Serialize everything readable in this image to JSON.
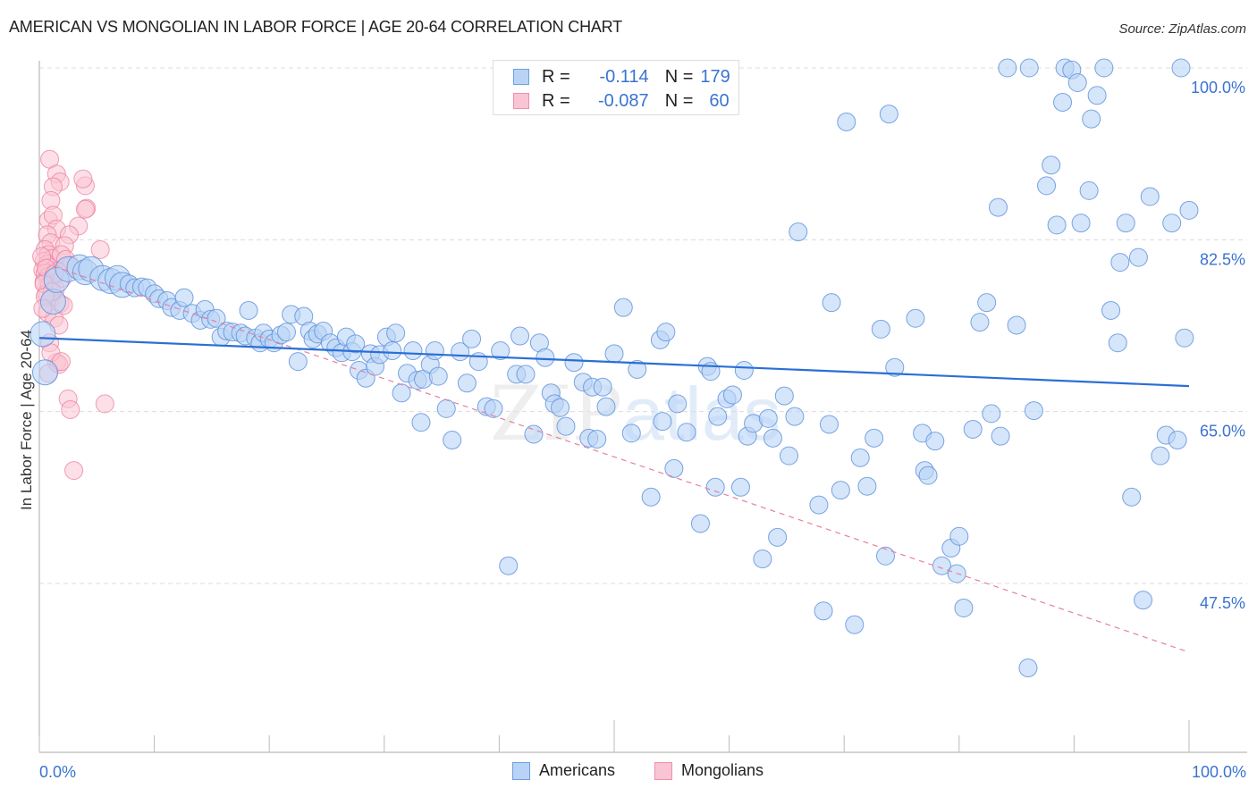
{
  "title": "AMERICAN VS MONGOLIAN IN LABOR FORCE | AGE 20-64 CORRELATION CHART",
  "source": "Source: ZipAtlas.com",
  "watermark": "ZIPatlas",
  "stats_legend": [
    {
      "series": "Americans",
      "r_label": "R =",
      "r_value": "-0.114",
      "n_label": "N =",
      "n_value": "179"
    },
    {
      "series": "Mongolians",
      "r_label": "R =",
      "r_value": "-0.087",
      "n_label": "N =",
      "n_value": "60"
    }
  ],
  "colors": {
    "americans_fill": "#b9d3f7",
    "americans_stroke": "#5b8fd9",
    "americans_trend": "#2a6fd6",
    "mongolians_fill": "#f9c5d4",
    "mongolians_stroke": "#ec7d9d",
    "mongolians_trend": "#e8809c",
    "axis_text": "#3a73d0",
    "grid": "#dcdcdc"
  },
  "chart_data": {
    "type": "scatter",
    "title": "AMERICAN VS MONGOLIAN IN LABOR FORCE | AGE 20-64 CORRELATION CHART",
    "xlabel": "",
    "ylabel": "In Labor Force | Age 20-64",
    "xlim": [
      0,
      100
    ],
    "ylim": [
      31.6,
      102.3
    ],
    "x_tick_labels": [
      "0.0%",
      "100.0%"
    ],
    "x_ticks": [
      0,
      10,
      20,
      30,
      40,
      50,
      60,
      70,
      80,
      90,
      100
    ],
    "y_ticks": [
      100.0,
      82.5,
      65.0,
      47.5
    ],
    "y_tick_labels": [
      "100.0%",
      "82.5%",
      "65.0%",
      "47.5%"
    ],
    "grid": true,
    "legend_position": "bottom-center",
    "legend": [
      "Americans",
      "Mongolians"
    ],
    "series": [
      {
        "name": "Americans",
        "trendline": {
          "x": [
            0,
            100
          ],
          "y": [
            72.5,
            67.6
          ]
        },
        "points": [
          [
            0.3,
            72.9
          ],
          [
            0.5,
            69.0
          ],
          [
            1.2,
            76.2
          ],
          [
            1.5,
            78.4
          ],
          [
            2.5,
            79.5
          ],
          [
            3.5,
            79.7
          ],
          [
            4.0,
            79.2
          ],
          [
            4.5,
            79.5
          ],
          [
            5.5,
            78.6
          ],
          [
            6.2,
            78.3
          ],
          [
            6.8,
            78.6
          ],
          [
            7.2,
            77.9
          ],
          [
            7.8,
            78.0
          ],
          [
            8.3,
            77.6
          ],
          [
            8.9,
            77.7
          ],
          [
            9.4,
            77.6
          ],
          [
            10.0,
            77.0
          ],
          [
            10.4,
            76.5
          ],
          [
            11.1,
            76.3
          ],
          [
            11.5,
            75.6
          ],
          [
            12.2,
            75.3
          ],
          [
            12.6,
            76.6
          ],
          [
            13.3,
            75.0
          ],
          [
            14.0,
            74.3
          ],
          [
            14.4,
            75.4
          ],
          [
            14.9,
            74.4
          ],
          [
            15.4,
            74.5
          ],
          [
            15.8,
            72.6
          ],
          [
            16.3,
            73.2
          ],
          [
            16.8,
            73.1
          ],
          [
            17.5,
            73.0
          ],
          [
            17.9,
            72.7
          ],
          [
            18.2,
            75.3
          ],
          [
            18.8,
            72.5
          ],
          [
            19.2,
            72.0
          ],
          [
            19.5,
            73.0
          ],
          [
            20.0,
            72.4
          ],
          [
            20.4,
            72.0
          ],
          [
            21.0,
            72.8
          ],
          [
            21.5,
            73.1
          ],
          [
            21.9,
            74.9
          ],
          [
            22.5,
            70.1
          ],
          [
            23.0,
            74.7
          ],
          [
            23.5,
            73.2
          ],
          [
            23.8,
            72.4
          ],
          [
            24.2,
            72.9
          ],
          [
            24.7,
            73.2
          ],
          [
            25.3,
            72.0
          ],
          [
            25.8,
            71.5
          ],
          [
            26.3,
            71.0
          ],
          [
            26.7,
            72.6
          ],
          [
            27.2,
            71.1
          ],
          [
            27.5,
            71.9
          ],
          [
            27.8,
            69.2
          ],
          [
            28.4,
            68.4
          ],
          [
            28.8,
            70.9
          ],
          [
            29.2,
            69.6
          ],
          [
            29.6,
            70.8
          ],
          [
            30.2,
            72.6
          ],
          [
            30.7,
            71.2
          ],
          [
            31.0,
            73.0
          ],
          [
            31.5,
            66.9
          ],
          [
            32.0,
            68.9
          ],
          [
            32.5,
            71.2
          ],
          [
            32.9,
            68.2
          ],
          [
            33.2,
            63.9
          ],
          [
            33.4,
            68.3
          ],
          [
            34.0,
            69.8
          ],
          [
            34.4,
            71.2
          ],
          [
            34.7,
            68.6
          ],
          [
            35.4,
            65.3
          ],
          [
            35.9,
            62.1
          ],
          [
            36.6,
            71.1
          ],
          [
            37.2,
            67.9
          ],
          [
            37.6,
            72.4
          ],
          [
            38.2,
            70.1
          ],
          [
            38.9,
            65.5
          ],
          [
            39.5,
            65.3
          ],
          [
            40.1,
            71.2
          ],
          [
            40.8,
            49.3
          ],
          [
            41.5,
            68.8
          ],
          [
            41.8,
            72.7
          ],
          [
            42.3,
            68.8
          ],
          [
            43.0,
            62.7
          ],
          [
            43.5,
            72.0
          ],
          [
            44.0,
            70.5
          ],
          [
            44.5,
            66.9
          ],
          [
            44.8,
            65.8
          ],
          [
            45.3,
            65.4
          ],
          [
            45.8,
            63.5
          ],
          [
            46.5,
            70.0
          ],
          [
            47.3,
            68.0
          ],
          [
            47.8,
            62.3
          ],
          [
            48.1,
            67.5
          ],
          [
            48.5,
            62.2
          ],
          [
            49.0,
            67.5
          ],
          [
            49.3,
            65.5
          ],
          [
            50.0,
            70.9
          ],
          [
            50.8,
            75.6
          ],
          [
            51.5,
            62.8
          ],
          [
            52.0,
            69.3
          ],
          [
            53.2,
            56.3
          ],
          [
            54.0,
            72.3
          ],
          [
            54.2,
            64.0
          ],
          [
            54.5,
            73.1
          ],
          [
            55.2,
            59.2
          ],
          [
            55.5,
            65.8
          ],
          [
            56.3,
            62.9
          ],
          [
            57.5,
            53.6
          ],
          [
            58.1,
            69.6
          ],
          [
            58.4,
            69.1
          ],
          [
            58.8,
            57.3
          ],
          [
            59.0,
            64.5
          ],
          [
            59.8,
            66.3
          ],
          [
            60.3,
            66.7
          ],
          [
            61.0,
            57.3
          ],
          [
            61.3,
            69.2
          ],
          [
            61.6,
            62.5
          ],
          [
            62.1,
            63.8
          ],
          [
            62.9,
            50.0
          ],
          [
            63.4,
            64.3
          ],
          [
            63.8,
            62.3
          ],
          [
            64.2,
            52.2
          ],
          [
            64.8,
            66.6
          ],
          [
            65.2,
            60.5
          ],
          [
            65.7,
            64.5
          ],
          [
            66.0,
            83.3
          ],
          [
            67.8,
            55.5
          ],
          [
            68.2,
            44.7
          ],
          [
            68.7,
            63.7
          ],
          [
            68.9,
            76.1
          ],
          [
            69.7,
            57.0
          ],
          [
            70.2,
            94.5
          ],
          [
            70.9,
            43.3
          ],
          [
            71.4,
            60.3
          ],
          [
            72.0,
            57.4
          ],
          [
            72.6,
            62.3
          ],
          [
            73.2,
            73.4
          ],
          [
            73.6,
            50.3
          ],
          [
            73.9,
            95.3
          ],
          [
            74.4,
            69.5
          ],
          [
            76.2,
            74.5
          ],
          [
            76.8,
            62.8
          ],
          [
            77.0,
            59.0
          ],
          [
            77.3,
            58.5
          ],
          [
            77.9,
            62.0
          ],
          [
            78.5,
            49.3
          ],
          [
            79.3,
            51.1
          ],
          [
            79.8,
            48.5
          ],
          [
            80.0,
            52.3
          ],
          [
            80.4,
            45.0
          ],
          [
            81.2,
            63.2
          ],
          [
            81.8,
            74.1
          ],
          [
            82.4,
            76.1
          ],
          [
            82.8,
            64.8
          ],
          [
            83.4,
            85.8
          ],
          [
            83.6,
            62.5
          ],
          [
            84.2,
            100.0
          ],
          [
            85.0,
            73.8
          ],
          [
            86.0,
            38.9
          ],
          [
            86.1,
            100.0
          ],
          [
            86.5,
            65.1
          ],
          [
            87.6,
            88.0
          ],
          [
            88.0,
            90.1
          ],
          [
            88.5,
            84.0
          ],
          [
            89.0,
            96.5
          ],
          [
            89.2,
            100.0
          ],
          [
            89.8,
            99.8
          ],
          [
            90.3,
            98.5
          ],
          [
            90.6,
            84.2
          ],
          [
            91.3,
            87.5
          ],
          [
            91.5,
            94.8
          ],
          [
            92.0,
            97.2
          ],
          [
            92.6,
            100.0
          ],
          [
            93.2,
            75.3
          ],
          [
            93.8,
            72.0
          ],
          [
            94.0,
            80.2
          ],
          [
            94.5,
            84.2
          ],
          [
            95.0,
            56.3
          ],
          [
            95.6,
            80.7
          ],
          [
            96.0,
            45.8
          ],
          [
            96.6,
            86.9
          ],
          [
            97.5,
            60.5
          ],
          [
            98.0,
            62.6
          ],
          [
            98.5,
            84.2
          ],
          [
            99.0,
            62.1
          ],
          [
            99.3,
            100.0
          ],
          [
            99.6,
            72.5
          ],
          [
            100.0,
            85.5
          ]
        ]
      },
      {
        "name": "Mongolians",
        "trendline": {
          "x": [
            1.2,
            100
          ],
          "y": [
            79.8,
            40.5
          ]
        },
        "points": [
          [
            0.9,
            90.7
          ],
          [
            1.5,
            89.2
          ],
          [
            1.8,
            88.4
          ],
          [
            1.2,
            87.9
          ],
          [
            1.0,
            86.5
          ],
          [
            0.8,
            84.5
          ],
          [
            1.2,
            85.0
          ],
          [
            1.5,
            83.6
          ],
          [
            0.7,
            83.0
          ],
          [
            1.0,
            82.2
          ],
          [
            0.5,
            81.5
          ],
          [
            0.8,
            81.0
          ],
          [
            1.1,
            80.6
          ],
          [
            0.4,
            80.3
          ],
          [
            0.7,
            80.0
          ],
          [
            0.9,
            79.7
          ],
          [
            0.3,
            79.4
          ],
          [
            0.5,
            79.1
          ],
          [
            0.8,
            78.8
          ],
          [
            1.2,
            78.5
          ],
          [
            0.4,
            78.2
          ],
          [
            0.9,
            77.9
          ],
          [
            1.4,
            77.5
          ],
          [
            0.6,
            77.0
          ],
          [
            1.0,
            76.5
          ],
          [
            1.8,
            76.0
          ],
          [
            0.7,
            75.1
          ],
          [
            1.3,
            74.5
          ],
          [
            1.7,
            73.8
          ],
          [
            0.9,
            72.0
          ],
          [
            1.5,
            70.0
          ],
          [
            1.7,
            69.8
          ],
          [
            0.8,
            68.9
          ],
          [
            2.5,
            66.3
          ],
          [
            2.7,
            65.2
          ],
          [
            3.0,
            59.0
          ],
          [
            4.1,
            85.7
          ],
          [
            4.0,
            85.6
          ],
          [
            4.0,
            88.0
          ],
          [
            3.8,
            88.7
          ],
          [
            5.3,
            81.5
          ],
          [
            3.4,
            83.9
          ],
          [
            2.6,
            83.0
          ],
          [
            2.2,
            81.9
          ],
          [
            1.9,
            81.0
          ],
          [
            2.3,
            80.5
          ],
          [
            2.7,
            79.9
          ],
          [
            1.6,
            79.3
          ],
          [
            2.0,
            78.6
          ],
          [
            0.2,
            80.8
          ],
          [
            0.6,
            79.6
          ],
          [
            1.3,
            79.0
          ],
          [
            0.4,
            78.0
          ],
          [
            1.1,
            77.2
          ],
          [
            0.5,
            76.7
          ],
          [
            2.1,
            75.8
          ],
          [
            0.3,
            75.5
          ],
          [
            1.0,
            71.0
          ],
          [
            1.9,
            70.1
          ],
          [
            5.7,
            65.8
          ]
        ]
      }
    ]
  },
  "bottom_legend": {
    "items": [
      "Americans",
      "Mongolians"
    ]
  },
  "x_axis": {
    "left_label": "0.0%",
    "right_label": "100.0%"
  }
}
